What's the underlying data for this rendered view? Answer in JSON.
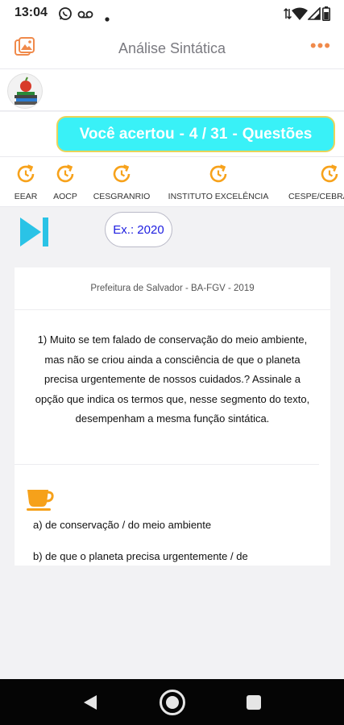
{
  "status_bar": {
    "time": "13:04"
  },
  "app_bar": {
    "title": "Análise Sintática",
    "more_icon": "more-dots-icon",
    "accent_color": "#f08a4b"
  },
  "score": {
    "prefix": "Você acertou",
    "sep1": "-",
    "value": "4 / 31",
    "sep2": "-",
    "suffix": "Questões",
    "bg_color": "#39f1f7"
  },
  "boards": [
    {
      "label": "EEAR",
      "icon": "refresh-clock-icon"
    },
    {
      "label": "AOCP",
      "icon": "refresh-clock-icon"
    },
    {
      "label": "CESGRANRIO",
      "icon": "refresh-clock-icon"
    },
    {
      "label": "INSTITUTO EXCELÊNCIA",
      "icon": "refresh-clock-icon"
    },
    {
      "label": "CESPE/CEBRASPE",
      "icon": "refresh-clock-icon"
    }
  ],
  "year_chip": {
    "label": "Ex.: 2020"
  },
  "question": {
    "source": "Prefeitura de Salvador - BA-FGV - 2019",
    "text": "1) Muito se tem falado de conservação do meio ambiente, mas não se criou ainda a consciência de que o planeta precisa urgentemente de nossos cuidados.? Assinale a opção que indica os termos que, nesse segmento do texto, desempenham a mesma função sintática.",
    "options": [
      "a) de conservação / do meio ambiente",
      "b) de que o planeta precisa urgentemente / de"
    ]
  }
}
